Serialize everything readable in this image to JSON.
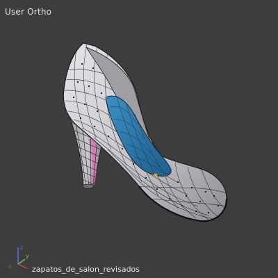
{
  "viewport": {
    "view_label": "User Ortho",
    "object_name": "zapatos_de_salon_revisados",
    "background_color": "#3d3d3d"
  },
  "axes": {
    "x": {
      "label": "x",
      "color": "#d9413a"
    },
    "y": {
      "label": "y",
      "color": "#7cc242"
    },
    "z": {
      "label": "z",
      "color": "#3e7ee8"
    }
  },
  "mesh": {
    "shell_color": "#c9c9ce",
    "insole_color": "#2a74a8",
    "wire_color": "#1c1c1c",
    "heel_inner_color": "#d27ab0"
  }
}
